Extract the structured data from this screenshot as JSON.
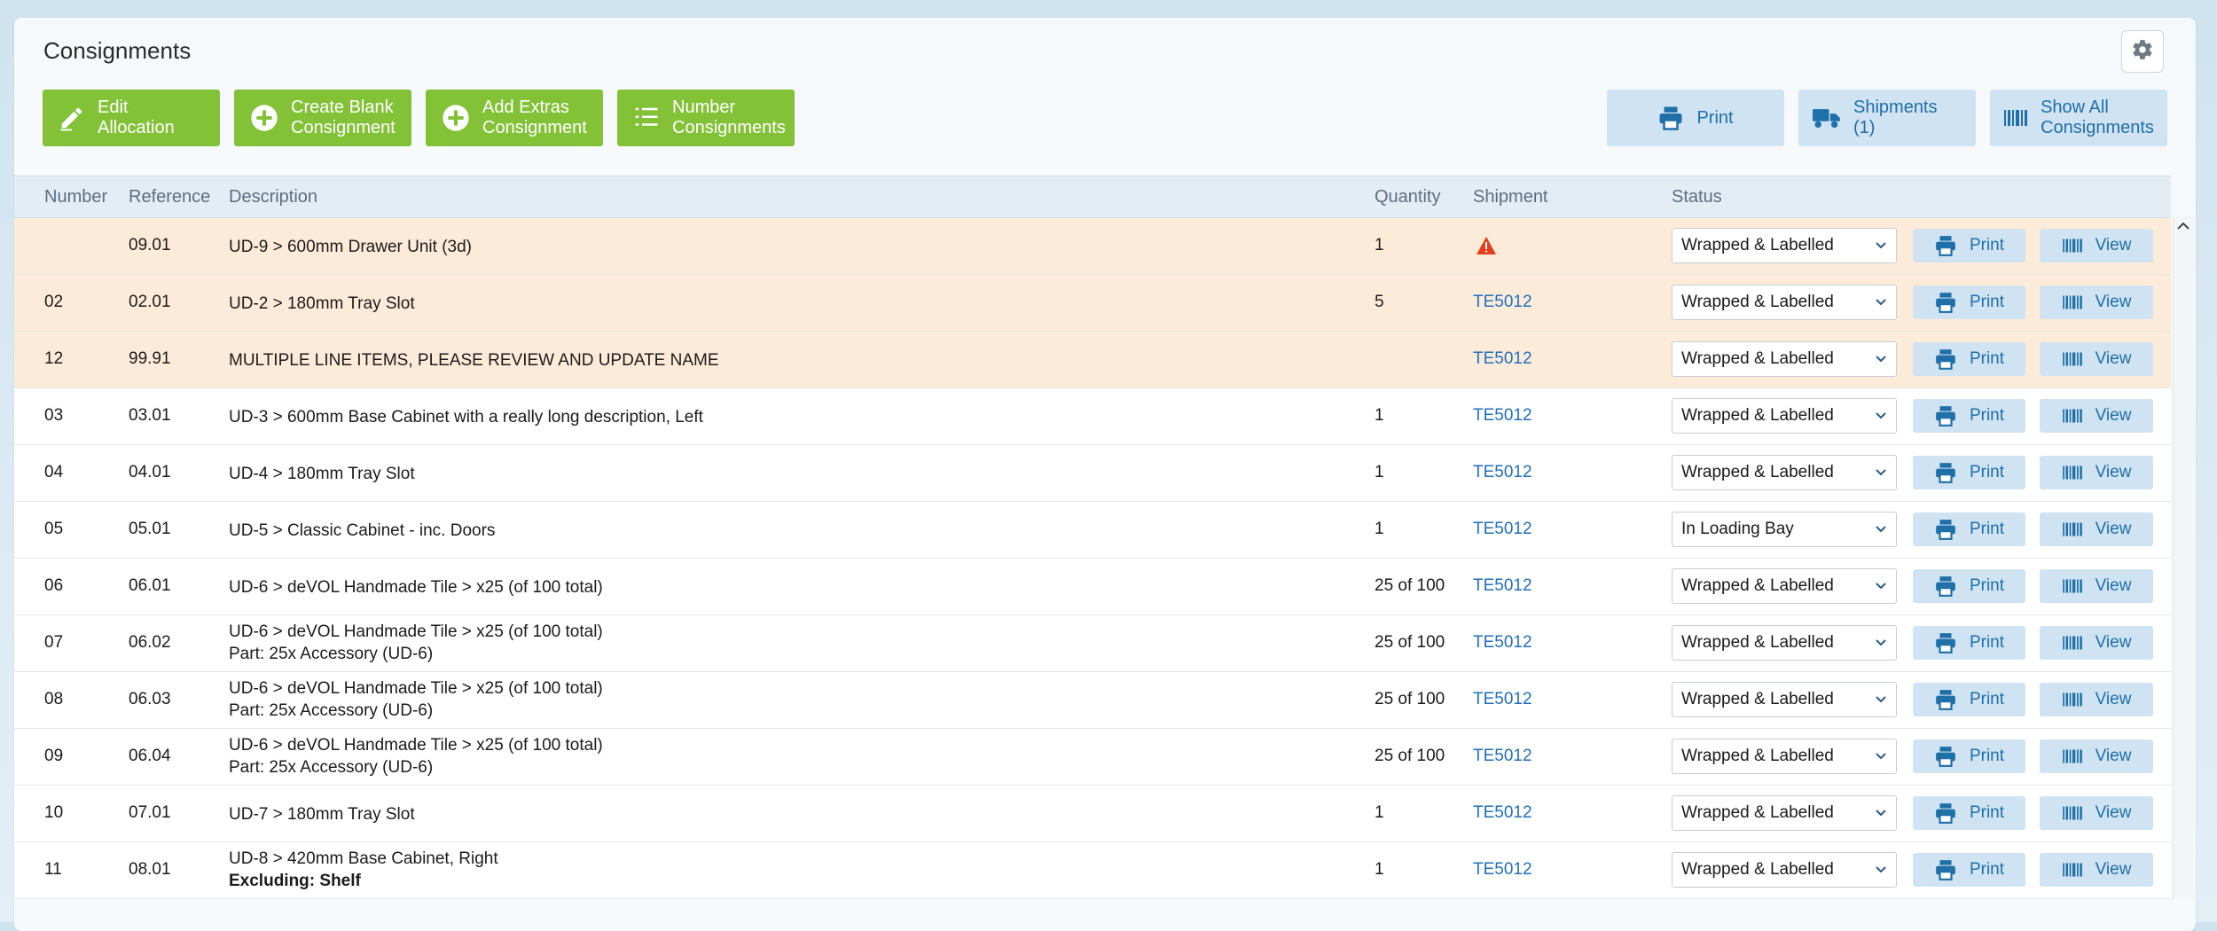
{
  "page": {
    "title": "Consignments"
  },
  "toolbar": {
    "edit_allocation": "Edit Allocation",
    "create_blank_line1": "Create Blank",
    "create_blank_line2": "Consignment",
    "add_extras_line1": "Add Extras",
    "add_extras_line2": "Consignment",
    "number_line1": "Number",
    "number_line2": "Consignments",
    "print": "Print",
    "shipments": "Shipments (1)",
    "show_all_line1": "Show All",
    "show_all_line2": "Consignments"
  },
  "columns": {
    "number": "Number",
    "reference": "Reference",
    "description": "Description",
    "quantity": "Quantity",
    "shipment": "Shipment",
    "status": "Status"
  },
  "actions": {
    "print": "Print",
    "view": "View"
  },
  "rows": [
    {
      "number": "",
      "reference": "09.01",
      "desc1": "UD-9 > 600mm Drawer Unit (3d)",
      "desc2": "",
      "quantity": "1",
      "shipment": "",
      "warning": true,
      "status": "Wrapped & Labelled",
      "highlight": true
    },
    {
      "number": "02",
      "reference": "02.01",
      "desc1": "UD-2 > 180mm Tray Slot",
      "desc2": "",
      "quantity": "5",
      "shipment": "TE5012",
      "status": "Wrapped & Labelled",
      "highlight": true
    },
    {
      "number": "12",
      "reference": "99.91",
      "desc1": "MULTIPLE LINE ITEMS, PLEASE REVIEW AND UPDATE NAME",
      "desc2": "",
      "quantity": "",
      "shipment": "TE5012",
      "status": "Wrapped & Labelled",
      "highlight": true
    },
    {
      "number": "03",
      "reference": "03.01",
      "desc1": "UD-3 > 600mm Base Cabinet with a really long description, Left",
      "desc2": "",
      "quantity": "1",
      "shipment": "TE5012",
      "status": "Wrapped & Labelled"
    },
    {
      "number": "04",
      "reference": "04.01",
      "desc1": "UD-4 > 180mm Tray Slot",
      "desc2": "",
      "quantity": "1",
      "shipment": "TE5012",
      "status": "Wrapped & Labelled"
    },
    {
      "number": "05",
      "reference": "05.01",
      "desc1": "UD-5 > Classic Cabinet - inc. Doors",
      "desc2": "",
      "quantity": "1",
      "shipment": "TE5012",
      "status": "In Loading Bay"
    },
    {
      "number": "06",
      "reference": "06.01",
      "desc1": "UD-6 > deVOL Handmade Tile > x25 (of 100 total)",
      "desc2": "",
      "quantity": "25 of 100",
      "shipment": "TE5012",
      "status": "Wrapped & Labelled"
    },
    {
      "number": "07",
      "reference": "06.02",
      "desc1": "UD-6 > deVOL Handmade Tile > x25 (of 100 total)",
      "desc2": "Part: 25x Accessory (UD-6)",
      "quantity": "25 of 100",
      "shipment": "TE5012",
      "status": "Wrapped & Labelled"
    },
    {
      "number": "08",
      "reference": "06.03",
      "desc1": "UD-6 > deVOL Handmade Tile > x25 (of 100 total)",
      "desc2": "Part: 25x Accessory (UD-6)",
      "quantity": "25 of 100",
      "shipment": "TE5012",
      "status": "Wrapped & Labelled"
    },
    {
      "number": "09",
      "reference": "06.04",
      "desc1": "UD-6 > deVOL Handmade Tile > x25 (of 100 total)",
      "desc2": "Part: 25x Accessory (UD-6)",
      "quantity": "25 of 100",
      "shipment": "TE5012",
      "status": "Wrapped & Labelled"
    },
    {
      "number": "10",
      "reference": "07.01",
      "desc1": "UD-7 > 180mm Tray Slot",
      "desc2": "",
      "quantity": "1",
      "shipment": "TE5012",
      "status": "Wrapped & Labelled"
    },
    {
      "number": "11",
      "reference": "08.01",
      "desc1": "UD-8 > 420mm Base Cabinet, Right",
      "desc2": "Excluding: Shelf",
      "desc2_bold": true,
      "quantity": "1",
      "shipment": "TE5012",
      "status": "Wrapped & Labelled"
    }
  ],
  "colors": {
    "green": "#83c237",
    "blue_btn": "#cfe3f3",
    "blue_text": "#1f6fa8",
    "link": "#1f6fbf",
    "warn_row": "#fdebd9",
    "warning_icon": "#e53e1e"
  }
}
